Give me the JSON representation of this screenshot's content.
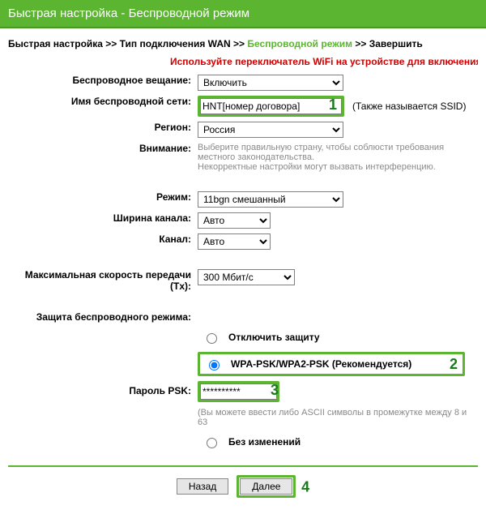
{
  "header": {
    "title": "Быстрая настройка - Беспроводной режим"
  },
  "breadcrumb": {
    "s1": "Быстрая настройка",
    "s2": "Тип подключения WAN",
    "s3": "Беспроводной режим",
    "s4": "Завершить",
    "sep": " >> "
  },
  "warning": "Используйте переключатель WiFi на устройстве для включения/от",
  "labels": {
    "broadcast": "Беспроводное вещание:",
    "ssid": "Имя беспроводной сети:",
    "region": "Регион:",
    "notice": "Внимание:",
    "mode": "Режим:",
    "chwidth": "Ширина канала:",
    "channel": "Канал:",
    "txrate": "Максимальная скорость передачи (Tx):",
    "security": "Защита беспроводного режима:",
    "psk": "Пароль PSK:"
  },
  "values": {
    "broadcast": "Включить",
    "ssid": "HNT[номер договора]",
    "region": "Россия",
    "mode": "11bgn смешанный",
    "chwidth": "Авто",
    "channel": "Авто",
    "txrate": "300 Мбит/с",
    "psk": "**********"
  },
  "notes": {
    "ssid_aka": "(Также называется SSID)",
    "region": "Выберите правильную страну, чтобы соблюсти требования местного законодательства.\nНекорректные настройки могут вызвать интерференцию.",
    "psk": "(Вы можете ввести либо ASCII символы в промежутке между 8 и 63"
  },
  "security": {
    "off": "Отключить защиту",
    "wpa": "WPA-PSK/WPA2-PSK (Рекомендуется)",
    "nochange": "Без изменений"
  },
  "buttons": {
    "back": "Назад",
    "next": "Далее"
  },
  "annots": {
    "n1": "1",
    "n2": "2",
    "n3": "3",
    "n4": "4"
  }
}
